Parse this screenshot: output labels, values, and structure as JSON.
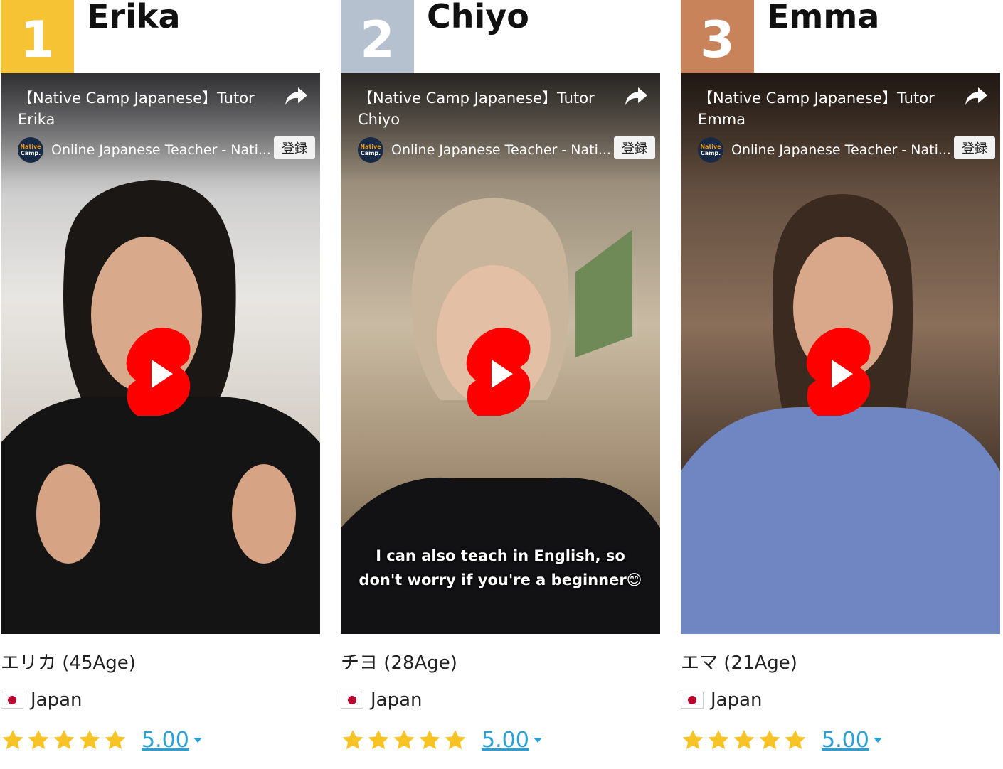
{
  "tutors": [
    {
      "rank": "1",
      "rank_color": "#f5c334",
      "name": "Erika",
      "video_title": "【Native Camp Japanese】Tutor Erika",
      "channel": "Online Japanese Teacher - Nati...",
      "subscribe": "登録",
      "caption": "",
      "meta": "エリカ (45Age)",
      "country": "Japan",
      "rating": "5.00",
      "stars": 5
    },
    {
      "rank": "2",
      "rank_color": "#b6c1cf",
      "name": "Chiyo",
      "video_title": "【Native Camp Japanese】Tutor Chiyo",
      "channel": "Online Japanese Teacher - Nati...",
      "subscribe": "登録",
      "caption_line1": "I can also teach in English, so",
      "caption_line2": "don't worry if you're a beginner😊",
      "meta": "チヨ (28Age)",
      "country": "Japan",
      "rating": "5.00",
      "stars": 5
    },
    {
      "rank": "3",
      "rank_color": "#c9835a",
      "name": "Emma",
      "video_title": "【Native Camp Japanese】Tutor Emma",
      "channel": "Online Japanese Teacher - Nati...",
      "subscribe": "登録",
      "caption": "",
      "meta": "エマ (21Age)",
      "country": "Japan",
      "rating": "5.00",
      "stars": 5
    }
  ],
  "channel_logo": {
    "line1": "Native",
    "line2": "Camp."
  },
  "colors": {
    "star": "#f7c325",
    "link": "#2aa1d6",
    "play_red": "#ff0000"
  },
  "icons": {
    "share": "share-arrow-icon",
    "play": "youtube-shorts-play-icon",
    "star": "star-icon",
    "flag": "japan-flag-icon"
  }
}
